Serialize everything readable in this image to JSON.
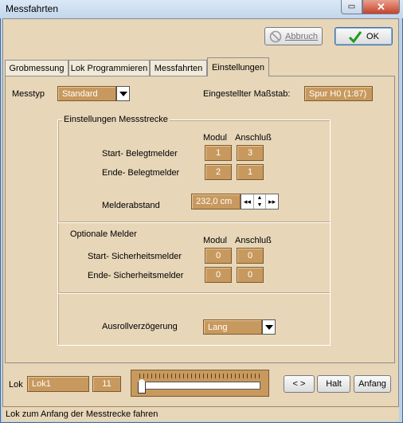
{
  "window": {
    "title": "Messfahrten"
  },
  "header": {
    "cancel_label": "Abbruch",
    "ok_label": "OK"
  },
  "tabs": [
    "Grobmessung",
    "Lok Programmieren",
    "Messfahrten",
    "Einstellungen"
  ],
  "settings": {
    "messtyp_label": "Messtyp",
    "messtyp_value": "Standard",
    "scale_label": "Eingestellter Maßstab:",
    "scale_value": "Spur H0 (1:87)",
    "track_group_title": "Einstellungen Messstrecke",
    "col_modul": "Modul",
    "col_anschluss": "Anschluß",
    "start_belegt_label": "Start- Belegtmelder",
    "start_belegt_modul": "1",
    "start_belegt_anschluss": "3",
    "ende_belegt_label": "Ende- Belegtmelder",
    "ende_belegt_modul": "2",
    "ende_belegt_anschluss": "1",
    "melderabstand_label": "Melderabstand",
    "melderabstand_value": "232,0 cm",
    "optional_title": "Optionale Melder",
    "start_sicher_label": "Start- Sicherheitsmelder",
    "start_sicher_modul": "0",
    "start_sicher_anschluss": "0",
    "ende_sicher_label": "Ende- Sicherheitsmelder",
    "ende_sicher_modul": "0",
    "ende_sicher_anschluss": "0",
    "ausroll_label": "Ausrollverzögerung",
    "ausroll_value": "Lang"
  },
  "bottom": {
    "lok_label": "Lok",
    "lok_name": "Lok1",
    "lok_address": "11",
    "speed_fraction": 0.0,
    "btn_direction": "< >",
    "btn_halt": "Halt",
    "btn_anfang": "Anfang"
  },
  "status": {
    "text": "Lok zum Anfang der Messtrecke fahren"
  },
  "icons": {
    "cancel": "no-entry-icon",
    "ok": "green-checkmark-icon"
  }
}
